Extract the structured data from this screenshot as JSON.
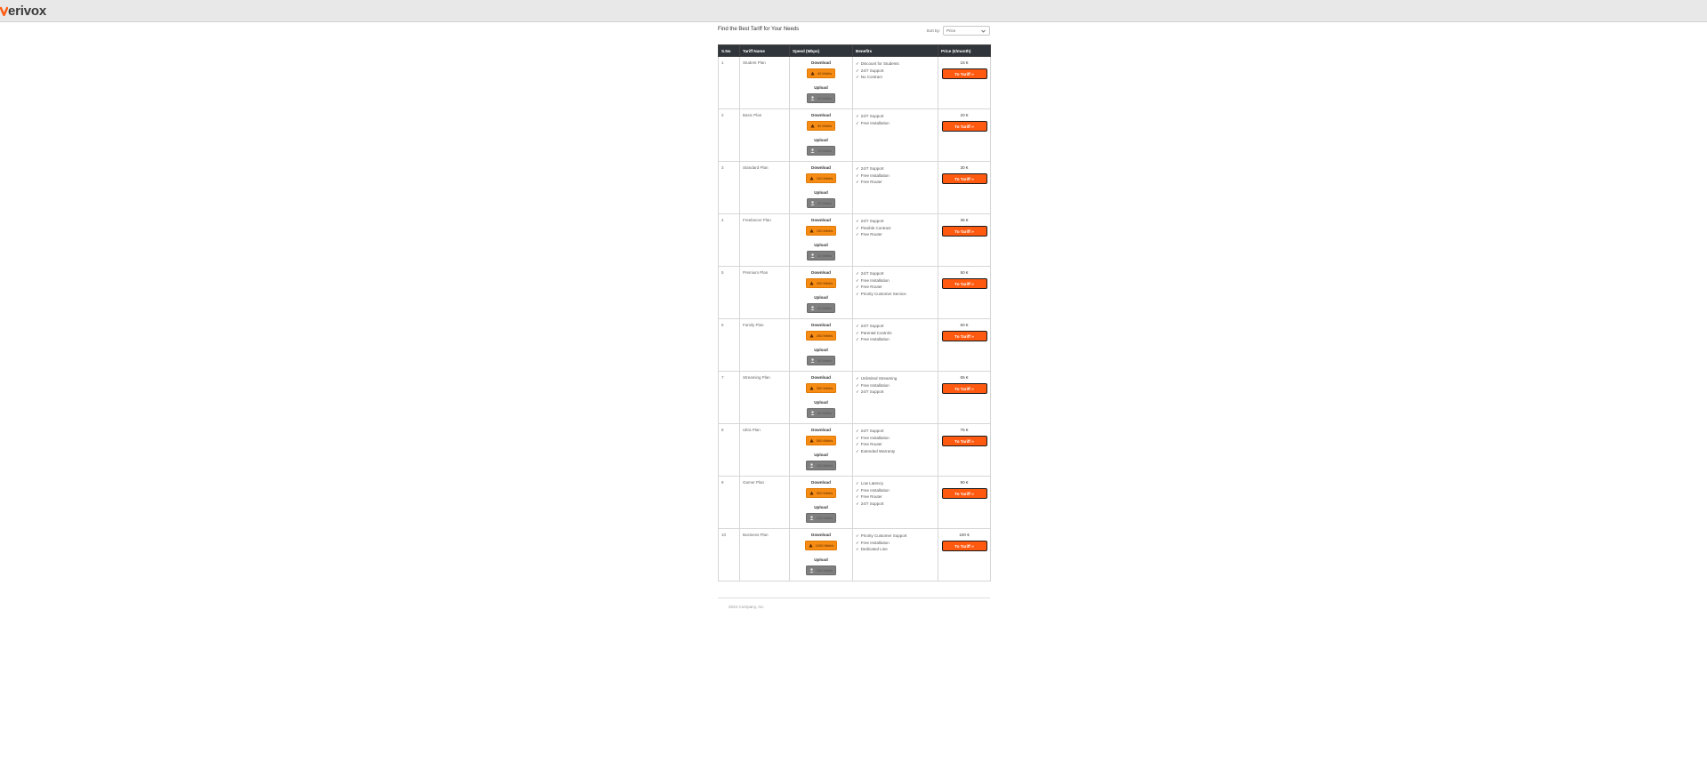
{
  "app": {
    "logo_text": "erivox"
  },
  "page": {
    "title": "Find the Best Tariff for Your Needs"
  },
  "sort": {
    "label": "Sort by:",
    "selected": "Price"
  },
  "table": {
    "headers": [
      "S.No",
      "Tariff Name",
      "Speed (Mbps)",
      "Benefits",
      "Price (€/month)"
    ],
    "download_label": "Download",
    "upload_label": "Upload",
    "button_label": "To Tariff »",
    "rows": [
      {
        "sno": "1",
        "name": "Student Plan",
        "download": "40 Mbit/s",
        "upload": "10 Mbit/s",
        "benefits": [
          "Discount for Students",
          "24/7 Support",
          "No Contract"
        ],
        "price": "15 €"
      },
      {
        "sno": "2",
        "name": "Basic Plan",
        "download": "50 Mbit/s",
        "upload": "10 Mbit/s",
        "benefits": [
          "24/7 Support",
          "Free Installation"
        ],
        "price": "20 €"
      },
      {
        "sno": "3",
        "name": "Standard Plan",
        "download": "100 Mbit/s",
        "upload": "20 Mbit/s",
        "benefits": [
          "24/7 Support",
          "Free Installation",
          "Free Router"
        ],
        "price": "30 €"
      },
      {
        "sno": "4",
        "name": "Freelancer Plan",
        "download": "150 Mbit/s",
        "upload": "30 Mbit/s",
        "benefits": [
          "24/7 Support",
          "Flexible Contract",
          "Free Router"
        ],
        "price": "35 €"
      },
      {
        "sno": "5",
        "name": "Premium Plan",
        "download": "200 Mbit/s",
        "upload": "40 Mbit/s",
        "benefits": [
          "24/7 Support",
          "Free Installation",
          "Free Router",
          "Priority Customer Service"
        ],
        "price": "50 €"
      },
      {
        "sno": "6",
        "name": "Family Plan",
        "download": "250 Mbit/s",
        "upload": "50 Mbit/s",
        "benefits": [
          "24/7 Support",
          "Parental Controls",
          "Free Installation"
        ],
        "price": "60 €"
      },
      {
        "sno": "7",
        "name": "Streaming Plan",
        "download": "300 Mbit/s",
        "upload": "60 Mbit/s",
        "benefits": [
          "Unlimited Streaming",
          "Free Installation",
          "24/7 Support"
        ],
        "price": "65 €"
      },
      {
        "sno": "8",
        "name": "Ultra Plan",
        "download": "500 Mbit/s",
        "upload": "100 Mbit/s",
        "benefits": [
          "24/7 Support",
          "Free Installation",
          "Free Router",
          "Extended Warranty"
        ],
        "price": "75 €"
      },
      {
        "sno": "9",
        "name": "Gamer Plan",
        "download": "500 Mbit/s",
        "upload": "100 Mbit/s",
        "benefits": [
          "Low Latency",
          "Free Installation",
          "Free Router",
          "24/7 Support"
        ],
        "price": "90 €"
      },
      {
        "sno": "10",
        "name": "Business Plan",
        "download": "1000 Mbit/s",
        "upload": "200 Mbit/s",
        "benefits": [
          "Priority Customer Support",
          "Free Installation",
          "Dedicated Line"
        ],
        "price": "100 €"
      }
    ]
  },
  "footer": {
    "text": "2024 Company, Inc"
  },
  "colors": {
    "accent": "#ff5a10",
    "download": "#f78c14",
    "upload": "#7f7f7f",
    "header_bg": "#2f353a",
    "logo_v": "#ff5a10"
  }
}
